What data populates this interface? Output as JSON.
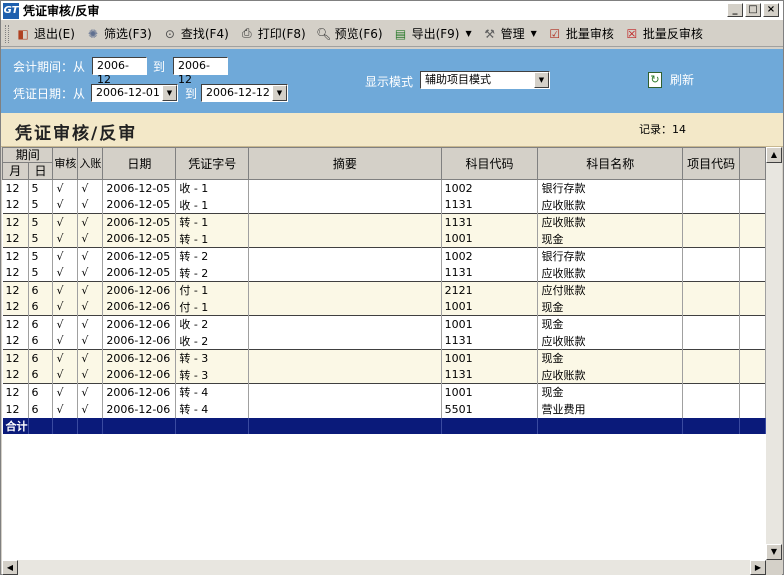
{
  "window": {
    "title": "凭证审核/反审",
    "app_icon_text": "GT"
  },
  "toolbar": [
    {
      "label": "退出(E)",
      "icon": "exit-icon",
      "glyph": "◧",
      "color": "#b04020"
    },
    {
      "label": "筛选(F3)",
      "icon": "filter-icon",
      "glyph": "✺",
      "color": "#607090"
    },
    {
      "label": "查找(F4)",
      "icon": "find-icon",
      "glyph": "⊙",
      "color": "#505050"
    },
    {
      "label": "打印(F8)",
      "icon": "print-icon",
      "glyph": "⎙",
      "color": "#303030"
    },
    {
      "label": "预览(F6)",
      "icon": "preview-icon",
      "glyph": "🔍︎",
      "color": "#303030"
    },
    {
      "label": "导出(F9)",
      "icon": "export-icon",
      "glyph": "▤",
      "color": "#2a7a2a",
      "dropdown": true
    },
    {
      "label": "管理",
      "icon": "manage-icon",
      "glyph": "⚒",
      "color": "#606060",
      "dropdown": true
    },
    {
      "label": "批量审核",
      "icon": "batch-audit-icon",
      "glyph": "☑",
      "color": "#b03020"
    },
    {
      "label": "批量反审核",
      "icon": "batch-unaudit-icon",
      "glyph": "☒",
      "color": "#c02020"
    }
  ],
  "filter": {
    "period_label": "会计期间：从",
    "period_from": "2006-12",
    "period_to_label": "到",
    "period_to": "2006-12",
    "date_label": "凭证日期：从",
    "date_from": "2006-12-01",
    "date_to_label": "到",
    "date_to": "2006-12-12",
    "mode_label": "显示模式",
    "mode_value": "辅助项目模式",
    "refresh_label": "刷新"
  },
  "page": {
    "title": "凭证审核/反审",
    "record_label": "记录：",
    "record_count": "14"
  },
  "table": {
    "header_group": "期间",
    "columns": {
      "month": "月",
      "day": "日",
      "audit": "审核",
      "post": "入账",
      "date": "日期",
      "voucher": "凭证字号",
      "summary": "摘要",
      "code": "科目代码",
      "name": "科目名称",
      "item": "项目代码"
    },
    "rows": [
      {
        "m": "12",
        "d": "5",
        "a": "√",
        "p": "√",
        "date": "2006-12-05",
        "v": "收 - 1",
        "s": "",
        "code": "1002",
        "name": "银行存款",
        "item": "",
        "g": 0,
        "start": true
      },
      {
        "m": "12",
        "d": "5",
        "a": "√",
        "p": "√",
        "date": "2006-12-05",
        "v": "收 - 1",
        "s": "",
        "code": "1131",
        "name": "应收账款",
        "item": "",
        "g": 0
      },
      {
        "m": "12",
        "d": "5",
        "a": "√",
        "p": "√",
        "date": "2006-12-05",
        "v": "转 - 1",
        "s": "",
        "code": "1131",
        "name": "应收账款",
        "item": "",
        "g": 1,
        "start": true
      },
      {
        "m": "12",
        "d": "5",
        "a": "√",
        "p": "√",
        "date": "2006-12-05",
        "v": "转 - 1",
        "s": "",
        "code": "1001",
        "name": "现金",
        "item": "",
        "g": 1
      },
      {
        "m": "12",
        "d": "5",
        "a": "√",
        "p": "√",
        "date": "2006-12-05",
        "v": "转 - 2",
        "s": "",
        "code": "1002",
        "name": "银行存款",
        "item": "",
        "g": 0,
        "start": true
      },
      {
        "m": "12",
        "d": "5",
        "a": "√",
        "p": "√",
        "date": "2006-12-05",
        "v": "转 - 2",
        "s": "",
        "code": "1131",
        "name": "应收账款",
        "item": "",
        "g": 0
      },
      {
        "m": "12",
        "d": "6",
        "a": "√",
        "p": "√",
        "date": "2006-12-06",
        "v": "付 - 1",
        "s": "",
        "code": "2121",
        "name": "应付账款",
        "item": "",
        "g": 1,
        "start": true
      },
      {
        "m": "12",
        "d": "6",
        "a": "√",
        "p": "√",
        "date": "2006-12-06",
        "v": "付 - 1",
        "s": "",
        "code": "1001",
        "name": "现金",
        "item": "",
        "g": 1
      },
      {
        "m": "12",
        "d": "6",
        "a": "√",
        "p": "√",
        "date": "2006-12-06",
        "v": "收 - 2",
        "s": "",
        "code": "1001",
        "name": "现金",
        "item": "",
        "g": 0,
        "start": true
      },
      {
        "m": "12",
        "d": "6",
        "a": "√",
        "p": "√",
        "date": "2006-12-06",
        "v": "收 - 2",
        "s": "",
        "code": "1131",
        "name": "应收账款",
        "item": "",
        "g": 0
      },
      {
        "m": "12",
        "d": "6",
        "a": "√",
        "p": "√",
        "date": "2006-12-06",
        "v": "转 - 3",
        "s": "",
        "code": "1001",
        "name": "现金",
        "item": "",
        "g": 1,
        "start": true
      },
      {
        "m": "12",
        "d": "6",
        "a": "√",
        "p": "√",
        "date": "2006-12-06",
        "v": "转 - 3",
        "s": "",
        "code": "1131",
        "name": "应收账款",
        "item": "",
        "g": 1
      },
      {
        "m": "12",
        "d": "6",
        "a": "√",
        "p": "√",
        "date": "2006-12-06",
        "v": "转 - 4",
        "s": "",
        "code": "1001",
        "name": "现金",
        "item": "",
        "g": 0,
        "start": true
      },
      {
        "m": "12",
        "d": "6",
        "a": "√",
        "p": "√",
        "date": "2006-12-06",
        "v": "转 - 4",
        "s": "",
        "code": "5501",
        "name": "营业费用",
        "item": "",
        "g": 0
      }
    ],
    "total_label": "合计"
  }
}
